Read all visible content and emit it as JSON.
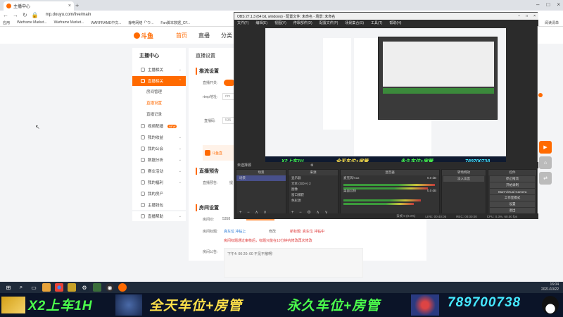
{
  "browser": {
    "tab_title": "主播中心",
    "url": "mp.douyu.com/live/main",
    "bookmarks": [
      "应用",
      "Warframe Market...",
      "Warframe Market...",
      "WARFRAME中文...",
      "静电网络「\"ウ...",
      "Fan脚本数据_CF..."
    ],
    "bookmarks_right": "阅读清单"
  },
  "site": {
    "logo_text": "斗鱼",
    "nav": [
      "首页",
      "直播",
      "分类"
    ]
  },
  "sidebar": {
    "title": "主播中心",
    "items": [
      {
        "label": "主播相关"
      },
      {
        "label": "直播相关"
      },
      {
        "label": "视频配播"
      },
      {
        "label": "我的收益"
      },
      {
        "label": "我的公会"
      },
      {
        "label": "数据分析"
      },
      {
        "label": "赛业活动"
      },
      {
        "label": "我的福利"
      },
      {
        "label": "我的房产"
      },
      {
        "label": "主播钱包"
      },
      {
        "label": "直播帮助"
      }
    ],
    "subitems": [
      "房间管理",
      "直播设置",
      "直播记录"
    ],
    "badge": "NEW"
  },
  "main": {
    "header": "直播设置",
    "sec_push": "推流设置",
    "rtmp_switch_label": "直播开关:",
    "rtmp_addr_label": "rtmp地址:",
    "rtmp_addr_value": "rtm",
    "rtmp_code_label": "直播码:",
    "rtmp_code_value": "535",
    "tool_text": "斗鱼直",
    "sec_preview": "直播预告",
    "preview_label": "直播预告:",
    "preview_value": "提",
    "sec_room": "房间设置",
    "room_id_label": "房间ID:",
    "room_id_value": "5358",
    "room_title_label": "房间标题:",
    "room_title_value": "真车位 冲钻上",
    "modify": "修改",
    "new_title": "新标题: 真车位 冲钻中",
    "warning": "房间标题通过审核后，标题只能在10分钟内修改再次修改",
    "notice_label": "房间公告:",
    "notice_value": "下午4: 00-20: 00 不见不散啊!"
  },
  "obs": {
    "title": "OBS 27.1.3 (64 bit, windows) - 配置文件: 未命名 - 场景: 未命名",
    "menu": [
      "文件(F)",
      "编辑(E)",
      "视图(V)",
      "停靠部件(D)",
      "配置文件(P)",
      "场景集合(S)",
      "工具(T)",
      "帮助(H)"
    ],
    "frame_title": "未选择源",
    "scenes_header": "场景",
    "scenes": [
      "场景"
    ],
    "sources_header": "来源",
    "sources": [
      "显示器",
      "文本 (GDI+) 2",
      "图像",
      "窗口捕获",
      "色彩源"
    ],
    "mixer_header": "混音器",
    "mixer_tracks": [
      {
        "name": "麦克风/Aux",
        "db": "0.0 dB"
      },
      {
        "name": "桌面音频",
        "db": "0.0 dB"
      }
    ],
    "transition_header": "转场特效",
    "transition_value": "淡入淡出",
    "controls_header": "控件",
    "controls": [
      "停止推流",
      "开始录制",
      "Start Virtual Camera",
      "工作室模式",
      "设置",
      "退出"
    ],
    "status": [
      "丢帧 0 (0.0%)",
      "LIVE: 00:40:05",
      "REC: 00:00:00",
      "CPU: 0.3%, 60.00 fps"
    ],
    "banner_texts": [
      "X2上车1H",
      "全天车位+房管",
      "永久车位+房管",
      "789700738"
    ]
  },
  "taskbar": {
    "icons": [
      "windows-icon",
      "search-icon",
      "task-view-icon",
      "chrome-icon",
      "folder-icon",
      "game-icon",
      "steam-icon",
      "obs-icon",
      "douyu-icon"
    ],
    "time": "16:04",
    "date": "2021/10/22"
  },
  "banner": {
    "texts": [
      "X2上车1H",
      "全天车位+房管",
      "永久车位+房管",
      "789700738"
    ],
    "colors": {
      "green": "#4cff4c",
      "yellow": "#ffe14a",
      "cyan": "#46e8ff"
    }
  },
  "colors": {
    "accent": "#ff6a00"
  }
}
